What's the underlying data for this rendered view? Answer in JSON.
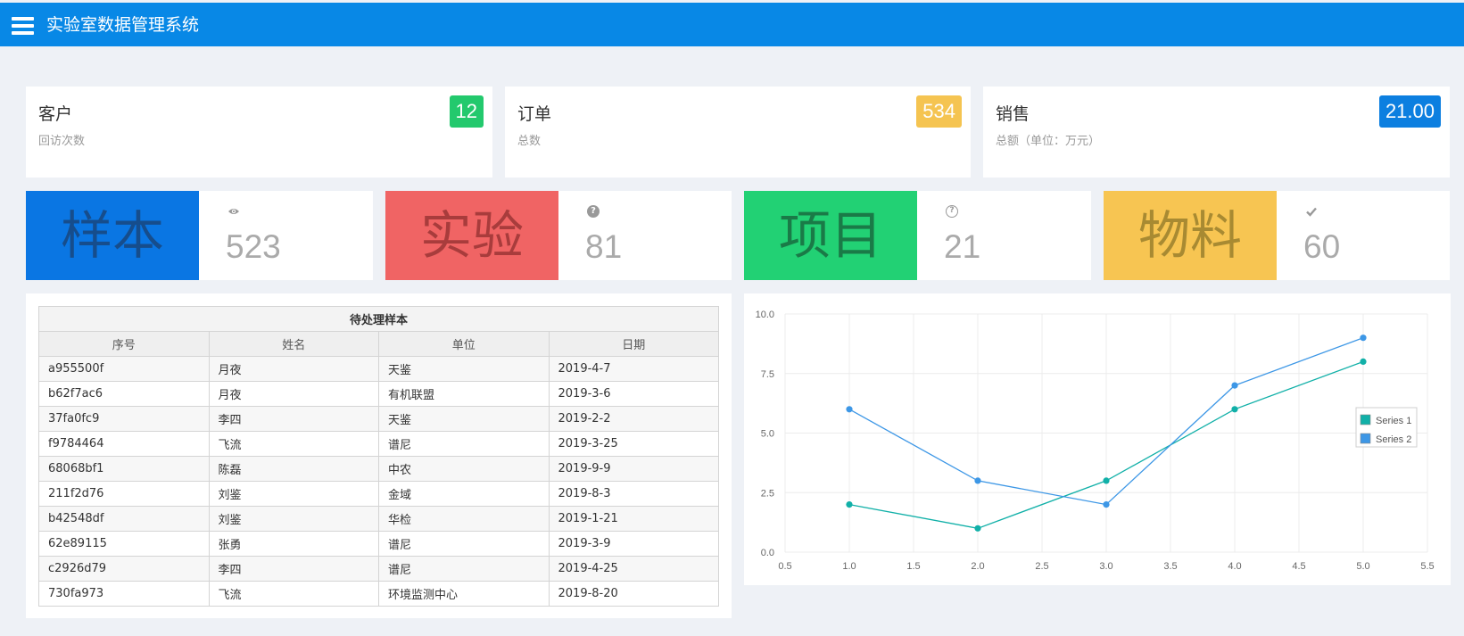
{
  "app": {
    "title": "实验室数据管理系统",
    "menu_icon": "hamburger-menu-icon"
  },
  "stat_cards": [
    {
      "title": "客户",
      "subtitle": "回访次数",
      "badge": "12",
      "badge_color": "#23c96d"
    },
    {
      "title": "订单",
      "subtitle": "总数",
      "badge": "534",
      "badge_color": "#f5c451"
    },
    {
      "title": "销售",
      "subtitle": "总额（单位：万元）",
      "badge": "21.00",
      "badge_color": "#0c7fe0"
    }
  ],
  "tiles": [
    {
      "label": "样本",
      "icon": "eye-icon",
      "value": "523",
      "block_color": "#0a76e3",
      "text_color": "#164d8c"
    },
    {
      "label": "实验",
      "icon": "question-circle-icon",
      "value": "81",
      "block_color": "#f06464",
      "text_color": "#a83c3c"
    },
    {
      "label": "项目",
      "icon": "question-circle-outline-icon",
      "value": "21",
      "block_color": "#22d174",
      "text_color": "#1a7a47"
    },
    {
      "label": "物料",
      "icon": "check-icon",
      "value": "60",
      "block_color": "#f7c552",
      "text_color": "#a88a32"
    }
  ],
  "samples_table": {
    "caption": "待处理样本",
    "columns": [
      "序号",
      "姓名",
      "单位",
      "日期"
    ],
    "rows": [
      [
        "a955500f",
        "月夜",
        "天鉴",
        "2019-4-7"
      ],
      [
        "b62f7ac6",
        "月夜",
        "有机联盟",
        "2019-3-6"
      ],
      [
        "37fa0fc9",
        "李四",
        "天鉴",
        "2019-2-2"
      ],
      [
        "f9784464",
        "飞流",
        "谱尼",
        "2019-3-25"
      ],
      [
        "68068bf1",
        "陈磊",
        "中农",
        "2019-9-9"
      ],
      [
        "211f2d76",
        "刘鉴",
        "金域",
        "2019-8-3"
      ],
      [
        "b42548df",
        "刘鉴",
        "华检",
        "2019-1-21"
      ],
      [
        "62e89115",
        "张勇",
        "谱尼",
        "2019-3-9"
      ],
      [
        "c2926d79",
        "李四",
        "谱尼",
        "2019-4-25"
      ],
      [
        "730fa973",
        "飞流",
        "环境监测中心",
        "2019-8-20"
      ]
    ]
  },
  "chart_data": {
    "type": "line",
    "x": [
      1,
      2,
      3,
      4,
      5
    ],
    "series": [
      {
        "name": "Series 1",
        "values": [
          2,
          1,
          3,
          6,
          8
        ],
        "color": "#11b0a8"
      },
      {
        "name": "Series 2",
        "values": [
          6,
          3,
          2,
          7,
          9
        ],
        "color": "#3d97e6"
      }
    ],
    "xlim": [
      0.5,
      5.5
    ],
    "ylim": [
      0,
      10
    ],
    "x_ticks": [
      "0.5",
      "1.0",
      "1.5",
      "2.0",
      "2.5",
      "3.0",
      "3.5",
      "4.0",
      "4.5",
      "5.0",
      "5.5"
    ],
    "y_ticks": [
      "0.0",
      "2.5",
      "5.0",
      "7.5",
      "10.0"
    ],
    "grid": true,
    "legend": "right"
  }
}
